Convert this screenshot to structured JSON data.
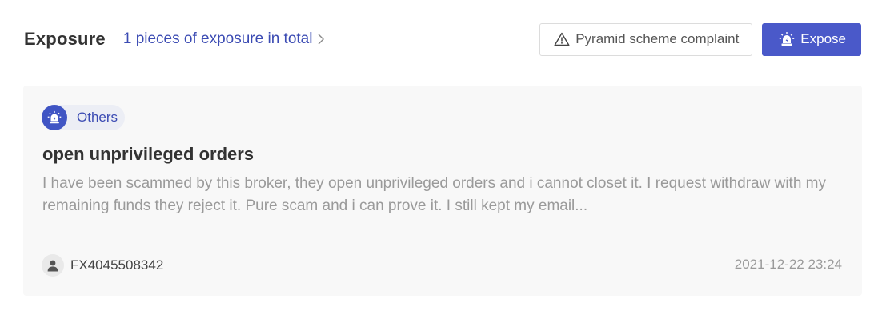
{
  "header": {
    "title": "Exposure",
    "total_link": "1 pieces of exposure in total",
    "complaint_button": "Pyramid scheme complaint",
    "expose_button": "Expose"
  },
  "colors": {
    "accent": "#4a59c9",
    "link": "#3b4bb3",
    "card_bg": "#f8f8f8",
    "muted_text": "#9a9a9a"
  },
  "icons": {
    "chevron": "chevron-right-icon",
    "complaint": "warning-triangle-icon",
    "expose": "alarm-light-icon",
    "tag": "alarm-light-icon",
    "avatar": "user-icon"
  },
  "exposures": [
    {
      "category": "Others",
      "title": "open unprivileged orders",
      "body": "I have been scammed by this broker, they open unprivileged orders and i cannot closet it. I request withdraw with my remaining funds they reject it. Pure scam and i can prove it. I still kept my email...",
      "author": "FX4045508342",
      "timestamp": "2021-12-22 23:24"
    }
  ]
}
